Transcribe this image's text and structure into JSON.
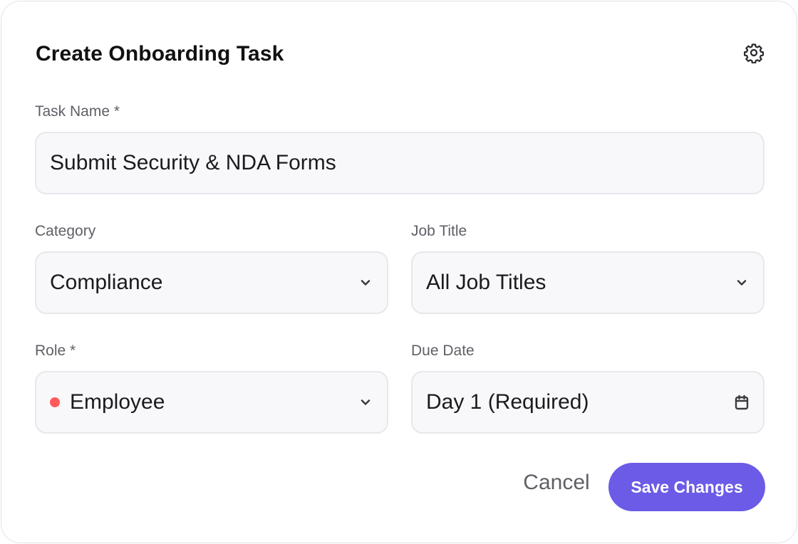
{
  "dialog": {
    "title": "Create Onboarding Task",
    "settings_icon": "gear-icon"
  },
  "form": {
    "task_name": {
      "label": "Task Name *",
      "value": "Submit Security & NDA Forms"
    },
    "category": {
      "label": "Category",
      "value": "Compliance",
      "icon": "chevron-down-icon"
    },
    "job_title": {
      "label": "Job Title",
      "value": "All Job Titles",
      "icon": "chevron-down-icon"
    },
    "role": {
      "label": "Role *",
      "value": "Employee",
      "indicator_color": "#ff5a5a",
      "icon": "chevron-down-icon"
    },
    "due_date": {
      "label": "Due Date",
      "value": "Day 1 (Required)",
      "icon": "calendar-icon"
    }
  },
  "actions": {
    "cancel_label": "Cancel",
    "save_label": "Save Changes"
  },
  "colors": {
    "accent": "#6b5be6",
    "role_dot": "#ff5a5a",
    "text_primary": "#1b1b1f",
    "text_secondary": "#5f5f66"
  }
}
